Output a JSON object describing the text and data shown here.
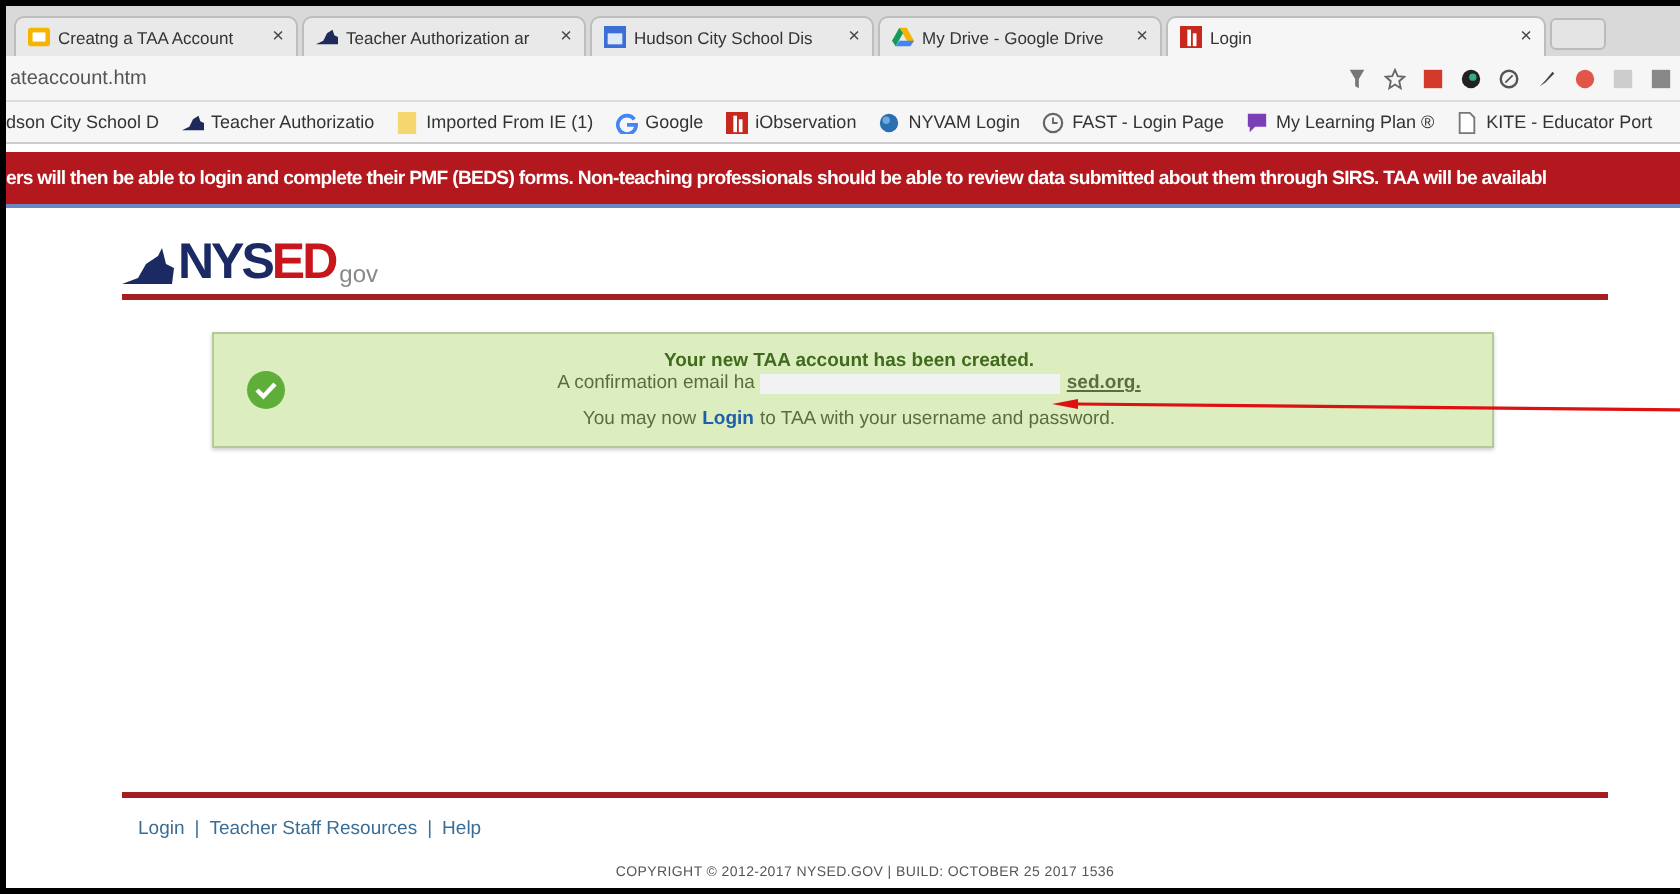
{
  "browser": {
    "tabs": [
      {
        "title": "Creatng a TAA Account",
        "close": "×",
        "selected": false
      },
      {
        "title": "Teacher Authorization ar",
        "close": "×",
        "selected": false
      },
      {
        "title": "Hudson City School Dis",
        "close": "×",
        "selected": false
      },
      {
        "title": "My Drive - Google Drive",
        "close": "×",
        "selected": false
      },
      {
        "title": "Login",
        "close": "×",
        "selected": true
      }
    ],
    "address": "ateaccount.htm",
    "bookmarks": [
      {
        "label": "dson City School D"
      },
      {
        "label": "Teacher Authorizatio"
      },
      {
        "label": "Imported From IE (1)"
      },
      {
        "label": "Google"
      },
      {
        "label": "iObservation"
      },
      {
        "label": "NYVAM Login"
      },
      {
        "label": "FAST - Login Page"
      },
      {
        "label": "My Learning Plan ®"
      },
      {
        "label": "KITE - Educator Port"
      }
    ]
  },
  "banner": "ers will then be able to login and complete their PMF (BEDS) forms. Non-teaching professionals should be able to review data submitted about them through SIRS. TAA will be availabl",
  "logo": {
    "prefix": "NYS",
    "accent": "ED",
    "suffix": "gov"
  },
  "message": {
    "title": "Your new TAA account has been created.",
    "email_prefix": "A confirmation email ha",
    "email_suffix": "sed.org.",
    "login_prefix": "You may now",
    "login_link": "Login",
    "login_suffix": "to TAA with your username and password."
  },
  "footer": {
    "links": [
      "Login",
      "Teacher Staff Resources",
      "Help"
    ],
    "separator": "|",
    "copyright": "COPYRIGHT © 2012-2017 NYSED.GOV | BUILD: OCTOBER 25 2017 1536"
  }
}
